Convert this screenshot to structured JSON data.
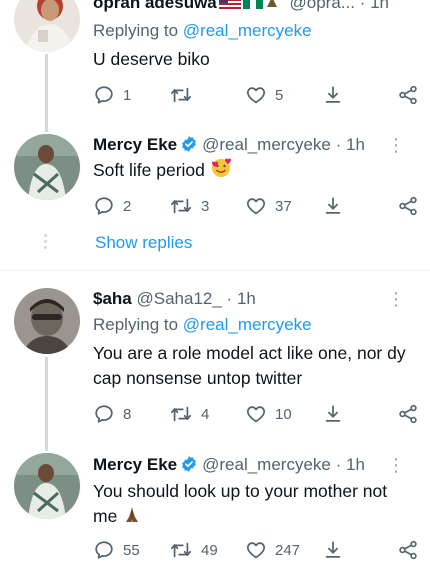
{
  "tweets": [
    {
      "name": "opran adesuwa",
      "handle": "@opra...",
      "time": "1h",
      "replying_prefix": "Replying to",
      "replying_to": "@real_mercyeke",
      "text": "U deserve biko",
      "replies": "1",
      "retweets": "",
      "likes": "5"
    },
    {
      "name": "Mercy Eke",
      "handle": "@real_mercyeke",
      "time": "1h",
      "text": "Soft life period",
      "replies": "2",
      "retweets": "3",
      "likes": "37",
      "show_replies": "Show replies"
    },
    {
      "name": "$aha",
      "handle": "@Saha12_",
      "time": "1h",
      "replying_prefix": "Replying to",
      "replying_to": "@real_mercyeke",
      "text": "You are a role model act like one, nor dy cap nonsense untop twitter",
      "replies": "8",
      "retweets": "4",
      "likes": "10"
    },
    {
      "name": "Mercy Eke",
      "handle": "@real_mercyeke",
      "time": "1h",
      "text": "You should look up to your mother not me",
      "replies": "55",
      "retweets": "49",
      "likes": "247"
    }
  ],
  "separator": "·",
  "colors": {
    "text": "#0f1419",
    "muted": "#536471",
    "accent": "#1d9bf0",
    "verified": "#1d9bf0",
    "divider": "#eff3f4"
  },
  "icons": [
    "reply-icon",
    "retweet-icon",
    "like-icon",
    "download-icon",
    "share-icon",
    "verified-icon",
    "more-icon"
  ]
}
